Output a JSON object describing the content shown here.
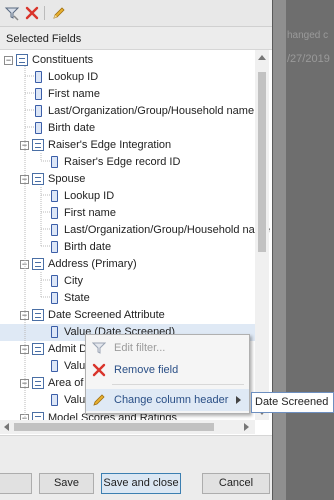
{
  "background": {
    "text_line1": "hanged c",
    "text_line2": "/27/2019"
  },
  "toolbar": {
    "icons": [
      "filter-icon",
      "remove-icon",
      "edit-icon"
    ]
  },
  "section_title": "Selected Fields",
  "tree": {
    "constituents": {
      "label": "Constituents",
      "children": [
        "Lookup ID",
        "First name",
        "Last/Organization/Group/Household name",
        "Birth date"
      ]
    },
    "re_integration": {
      "label": "Raiser's Edge Integration",
      "children": [
        "Raiser's Edge record ID"
      ]
    },
    "spouse": {
      "label": "Spouse",
      "children": [
        "Lookup ID",
        "First name",
        "Last/Organization/Group/Household name",
        "Birth date"
      ]
    },
    "address": {
      "label": "Address (Primary)",
      "children": [
        "City",
        "State"
      ]
    },
    "date_screened": {
      "label": "Date Screened Attribute",
      "children": [
        "Value (Date Screened)"
      ]
    },
    "admit": {
      "label": "Admit D",
      "children": [
        "Valu"
      ]
    },
    "area": {
      "label": "Area of",
      "children": [
        "Valu"
      ]
    },
    "model_scores": {
      "label": "Model Scores and Ratings"
    }
  },
  "context_menu": {
    "items": [
      {
        "label": "Edit filter...",
        "icon": "filter-icon",
        "enabled": false
      },
      {
        "label": "Remove field",
        "icon": "remove-icon",
        "enabled": true
      },
      {
        "label": "Change column header",
        "icon": "edit-icon",
        "enabled": true
      }
    ]
  },
  "inline_edit": {
    "value": "Date Screened"
  },
  "footer": {
    "save": "Save",
    "save_close": "Save and close",
    "cancel": "Cancel"
  },
  "colors": {
    "remove_red": "#d9342b",
    "pencil_yellow": "#e0a020",
    "icon_blue": "#3b5ea8"
  }
}
